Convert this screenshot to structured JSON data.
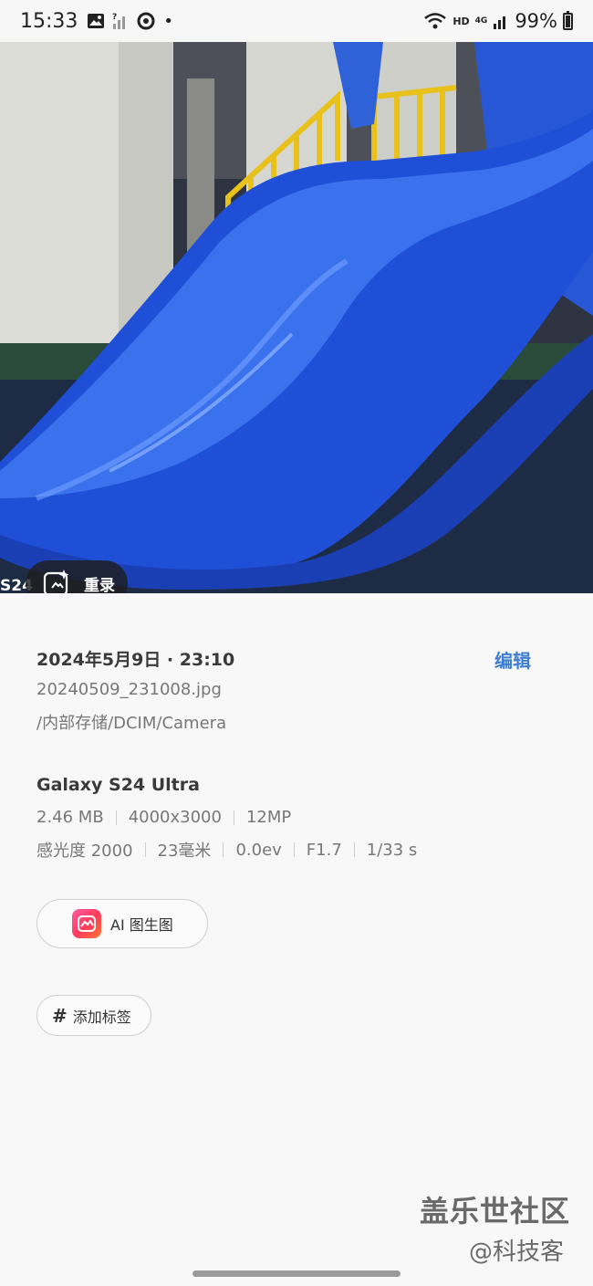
{
  "status_bar": {
    "time": "15:33",
    "network_label": "HD",
    "signal_label": "4G",
    "battery_pct": "99%",
    "notification_dot": "•"
  },
  "photo": {
    "caption": "S24",
    "remaster_label": "重录"
  },
  "details": {
    "date": "2024年5月9日 · 23:10",
    "edit_label": "编辑",
    "filename": "20240509_231008.jpg",
    "path": "/内部存储/DCIM/Camera",
    "device": "Galaxy S24 Ultra",
    "specs_row1": [
      "2.46 MB",
      "4000x3000",
      "12MP"
    ],
    "specs_row2": [
      "感光度 2000",
      "23毫米",
      "0.0ev",
      "F1.7",
      "1/33 s"
    ],
    "ai_button_label": "AI 图生图",
    "tag_button_label": "添加标签",
    "tag_symbol": "#"
  },
  "watermark": {
    "line1": "盖乐世社区",
    "line2": "@科技客"
  },
  "colors": {
    "accent": "#3e7ed0",
    "slide_blue": "#1f4fd6",
    "railing_yellow": "#e8c21a"
  }
}
